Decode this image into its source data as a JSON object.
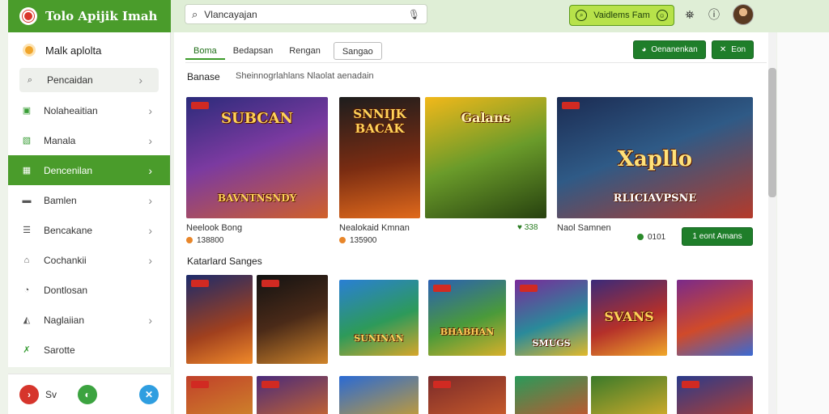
{
  "app": {
    "title": "Tolo Apijik Imah"
  },
  "topbar": {
    "search_value": "Vlancayajan",
    "cta_label": "Vaidlems Fam",
    "icons": [
      "bell-icon",
      "help-icon"
    ]
  },
  "sidebar": {
    "header": "Malk aplolta",
    "search_item": "Pencaidan",
    "items": [
      {
        "label": "Nolaheaitian",
        "icon": "box-icon"
      },
      {
        "label": "Manala",
        "icon": "image-icon"
      },
      {
        "label": "Dencenilan",
        "icon": "grid-icon"
      },
      {
        "label": "Bamlen",
        "icon": "folder-icon"
      },
      {
        "label": "Bencakane",
        "icon": "list-icon"
      },
      {
        "label": "Cochankii",
        "icon": "home-icon"
      },
      {
        "label": "Dontlosan",
        "icon": "chat-icon"
      },
      {
        "label": "Naglaiian",
        "icon": "chart-icon"
      },
      {
        "label": "Sarotte",
        "icon": "leaf-icon"
      }
    ],
    "active_index": 2,
    "bottom_label": "Sv"
  },
  "main": {
    "tabs": [
      {
        "label": "Boma"
      },
      {
        "label": "Bedapsan"
      },
      {
        "label": "Rengan"
      },
      {
        "label": "Sangao"
      }
    ],
    "btn_primary": "Oenanenkan",
    "btn_secondary": "Eon",
    "section_title": "Banase",
    "section_subtitle": "Sheinnogrlahlans Nlaolat aenadain",
    "featured": [
      {
        "art_text": "SUBCAN",
        "art_bottom": "BAVNTNSNDY"
      },
      {
        "art_text": "SNNIJK BACAK",
        "art_bottom": ""
      },
      {
        "art_text": "Galans",
        "art_bottom": ""
      },
      {
        "art_text": "Xapllo",
        "art_bottom": "RLICIAVPSNE"
      }
    ],
    "featured_meta": [
      {
        "name": "Neelook Bong",
        "value": "138800"
      },
      {
        "name": "Nealokaid Kmnan",
        "value": "135900"
      },
      {
        "name": "",
        "value": "♥ 338"
      },
      {
        "name": "Naol Samnen",
        "value": "0101"
      }
    ],
    "featured_button": "1 eont Amans",
    "collection_title": "Katarlard Sanges",
    "collection_art": [
      {
        "text": ""
      },
      {
        "text": ""
      },
      {
        "text": "SUNINAN"
      },
      {
        "text": "BHABHAN"
      },
      {
        "text": "SMUGS"
      },
      {
        "text": "SVANS"
      },
      {
        "text": ""
      }
    ]
  }
}
